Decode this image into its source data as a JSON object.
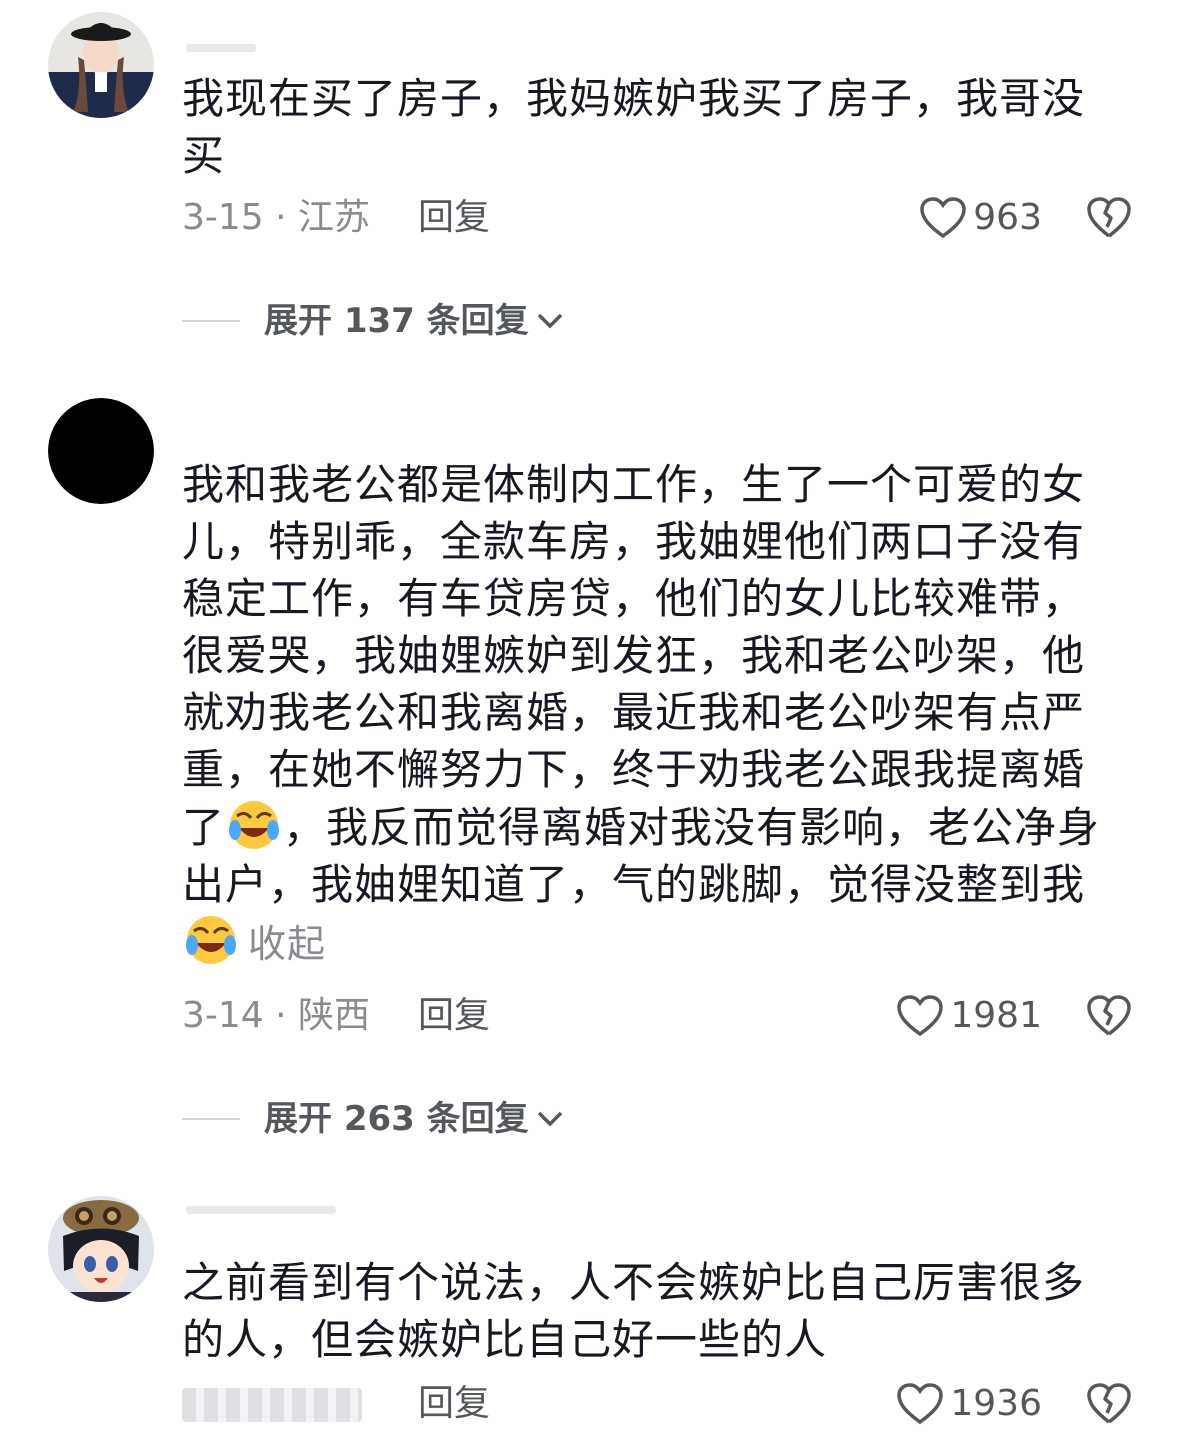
{
  "comments": [
    {
      "avatar": "woman-with-hat-avatar",
      "text": "我现在买了房子，我妈嫉妒我买了房子，我哥没买",
      "date_location": "3-15 · 江苏",
      "reply_label": "回复",
      "likes": "963",
      "expand_label": "展开 137 条回复"
    },
    {
      "avatar": "black-circle-avatar",
      "text_before_emoji1": "我和我老公都是体制内工作，生了一个可爱的女儿，特别乖，全款车房，我妯娌他们两口子没有稳定工作，有车贷房贷，他们的女儿比较难带，很爱哭，我妯娌嫉妒到发狂，我和老公吵架，他就劝我老公和我离婚，最近我和老公吵架有点严重，在她不懈努力下，终于劝我老公跟我提离婚了",
      "text_after_emoji1": "，我反而觉得离婚对我没有影响，老公净身出户，我妯娌知道了，气的跳脚，觉得没整到我",
      "collapse_label": "收起",
      "date_location": "3-14 · 陕西",
      "reply_label": "回复",
      "likes": "1981",
      "expand_label": "展开 263 条回复"
    },
    {
      "avatar": "anime-character-avatar",
      "text": "之前看到有个说法，人不会嫉妒比自己厉害很多的人，但会嫉妒比自己好一些的人",
      "reply_label": "回复",
      "likes": "1936"
    }
  ],
  "colors": {
    "text": "#161823",
    "meta": "#8a8b91",
    "icon": "#55575f"
  }
}
